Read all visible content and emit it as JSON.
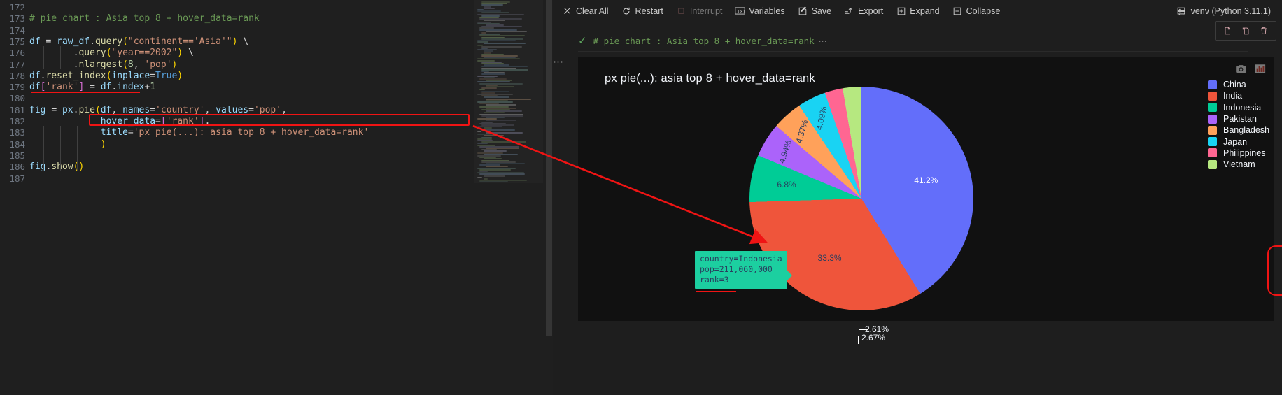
{
  "editor": {
    "first_line_number": 172,
    "lines": [
      {
        "n": 172,
        "text": ""
      },
      {
        "n": 173,
        "text": "# pie chart : Asia top 8 + hover_data=rank"
      },
      {
        "n": 174,
        "text": ""
      },
      {
        "n": 175,
        "text": "df = raw_df.query(\"continent=='Asia'\") \\"
      },
      {
        "n": 176,
        "text": "        .query(\"year==2002\") \\"
      },
      {
        "n": 177,
        "text": "        .nlargest(8, 'pop')"
      },
      {
        "n": 178,
        "text": "df.reset_index(inplace=True)"
      },
      {
        "n": 179,
        "text": "df['rank'] = df.index+1"
      },
      {
        "n": 180,
        "text": ""
      },
      {
        "n": 181,
        "text": "fig = px.pie(df, names='country', values='pop',"
      },
      {
        "n": 182,
        "text": "             hover_data=['rank'],"
      },
      {
        "n": 183,
        "text": "             title='px pie(...): asia top 8 + hover_data=rank'"
      },
      {
        "n": 184,
        "text": "             )"
      },
      {
        "n": 185,
        "text": ""
      },
      {
        "n": 186,
        "text": "fig.show()"
      },
      {
        "n": 187,
        "text": ""
      }
    ],
    "annotations": {
      "underline_line": 179,
      "box_line": 182,
      "accent_color": "#f01414"
    }
  },
  "toolbar": {
    "buttons": [
      {
        "label": "Clear All",
        "icon": "close-icon",
        "disabled": false
      },
      {
        "label": "Restart",
        "icon": "restart-icon",
        "disabled": false
      },
      {
        "label": "Interrupt",
        "icon": "stop-icon",
        "disabled": true
      },
      {
        "label": "Variables",
        "icon": "variables-icon",
        "disabled": false
      },
      {
        "label": "Save",
        "icon": "save-icon",
        "disabled": false
      },
      {
        "label": "Export",
        "icon": "export-icon",
        "disabled": false
      },
      {
        "label": "Expand",
        "icon": "expand-icon",
        "disabled": false
      },
      {
        "label": "Collapse",
        "icon": "collapse-icon",
        "disabled": false
      }
    ],
    "kernel": {
      "label": "venv (Python 3.11.1)",
      "icon": "server-icon"
    },
    "cell_actions": [
      {
        "name": "copy-cell-button",
        "icon": "copy-icon"
      },
      {
        "name": "duplicate-cell-button",
        "icon": "duplicate-icon"
      },
      {
        "name": "delete-cell-button",
        "icon": "trash-icon"
      }
    ]
  },
  "cell": {
    "status_icon": "checkmark-icon",
    "title": "# pie chart : Asia top 8 + hover_data=rank",
    "ellipsis": "⋯",
    "dots": "⋯"
  },
  "plot": {
    "modebar": [
      {
        "name": "download-plot-icon",
        "title": "camera"
      },
      {
        "name": "bar-chart-icon",
        "title": "chart"
      }
    ],
    "background": "#111111"
  },
  "tooltip": {
    "lines": [
      "country=Indonesia",
      "pop=211,060,000",
      "rank=3"
    ],
    "background": "#1ccfa0",
    "text_color": "#2a3f5f"
  },
  "chart_data": {
    "type": "pie",
    "title": "px pie(...): asia top 8 + hover_data=rank",
    "xlabel": "",
    "ylabel": "",
    "legend_position": "right",
    "labels": [
      "China",
      "India",
      "Indonesia",
      "Pakistan",
      "Bangladesh",
      "Japan",
      "Philippines",
      "Vietnam"
    ],
    "percents": [
      41.2,
      33.3,
      6.8,
      4.94,
      4.37,
      4.09,
      2.61,
      2.67
    ],
    "percent_text": [
      "41.2%",
      "33.3%",
      "6.8%",
      "4.94%",
      "4.37%",
      "4.09%",
      "2.61%",
      "2.67%"
    ],
    "colors": [
      "#636efa",
      "#ef553b",
      "#00cc96",
      "#ab63fa",
      "#ffa15a",
      "#19d3f3",
      "#ff6692",
      "#b6e880"
    ],
    "hover_fields": [
      "country",
      "pop",
      "rank"
    ],
    "hovered_slice": {
      "country": "Indonesia",
      "pop": "211,060,000",
      "rank": 3
    }
  }
}
